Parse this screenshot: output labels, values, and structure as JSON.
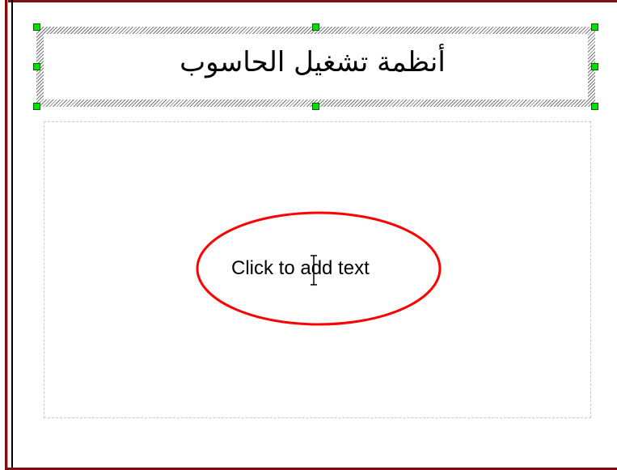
{
  "slide": {
    "title_placeholder": {
      "text": "أنظمة تشغيل الحاسوب",
      "selected": true
    },
    "body_placeholder": {
      "prompt_text": "Click to add text",
      "highlighted": true
    }
  },
  "colors": {
    "frame": "#7a1010",
    "handle_fill": "#00e000",
    "highlight_ellipse": "#ff0000",
    "placeholder_border": "#c8c8c8"
  },
  "icons": {
    "cursor": "i-beam-cursor-icon",
    "handles": "selection-handle-icon"
  }
}
